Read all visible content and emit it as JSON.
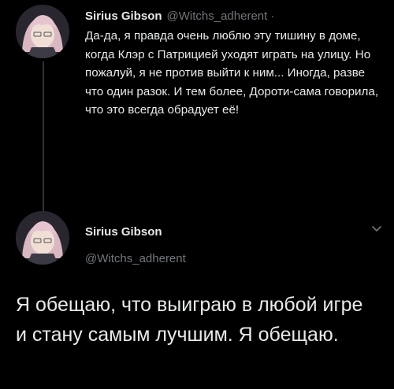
{
  "tweet_reply": {
    "author_name": "Sirius Gibson",
    "author_handle": "@Witchs_adherent",
    "separator": "·",
    "text": "Да-да, я правда очень люблю эту тишину в доме, когда Клэр с Патрицией уходят играть на улицу. Но пожалуй, я не против выйти к ним... Иногда, разве что один разок. И тем более, Дороти-сама говорила, что это всегда обрадует её!"
  },
  "tweet_main": {
    "author_name": "Sirius Gibson",
    "author_handle": "@Witchs_adherent",
    "text": "Я обещаю, что выиграю в любой игре и стану самым лучшим. Я обещаю."
  },
  "icons": {
    "menu": "chevron-down-icon",
    "avatar": "avatar"
  },
  "colors": {
    "background": "#000000",
    "primary_text": "#e7e9ea",
    "secondary_text": "#71767b",
    "thread_line": "#2f3336"
  }
}
